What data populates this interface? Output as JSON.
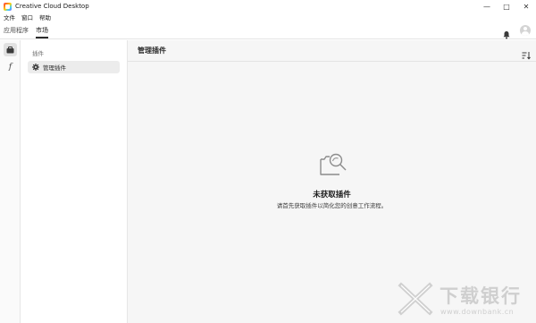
{
  "window": {
    "title": "Creative Cloud Desktop",
    "minimize": "—",
    "maximize": "□",
    "close": "✕"
  },
  "menubar": [
    "文件",
    "窗口",
    "帮助"
  ],
  "tabs": [
    {
      "label": "应用程序",
      "active": false
    },
    {
      "label": "市场",
      "active": true
    }
  ],
  "header_icons": [
    "bell-icon",
    "avatar"
  ],
  "rail": {
    "items": [
      "plugins-box-icon",
      "fonts-f-icon"
    ],
    "fonts_glyph": "f"
  },
  "sidebar": {
    "heading": "插件",
    "items": [
      {
        "label": "管理插件",
        "icon": "gear-icon",
        "selected": true
      }
    ]
  },
  "main": {
    "title": "管理插件",
    "sort_icon": "sort-icon",
    "empty_state": {
      "icon": "folder-search-icon",
      "title": "未获取插件",
      "description": "请首先获取插件以简化您的创意工作流程。"
    }
  },
  "watermark": {
    "text": "下载银行",
    "url": "www.downbank.cn"
  },
  "colors": {
    "accent": "#2c2c2c",
    "main_bg": "#f6f6f6",
    "selected_bg": "#ececec"
  }
}
